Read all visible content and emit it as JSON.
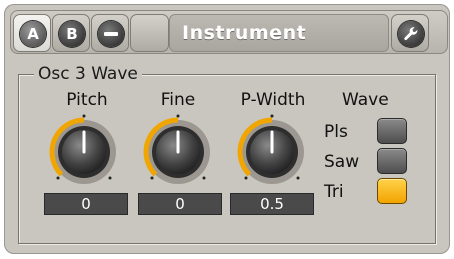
{
  "header": {
    "btn_a": "A",
    "btn_b": "B",
    "title": "Instrument",
    "icons": {
      "minus": "minus-icon",
      "wrench": "wrench-icon"
    }
  },
  "group": {
    "label": "Osc 3 Wave"
  },
  "knobs": [
    {
      "label": "Pitch",
      "value": "0"
    },
    {
      "label": "Fine",
      "value": "0"
    },
    {
      "label": "P-Width",
      "value": "0.5"
    }
  ],
  "wave": {
    "title": "Wave",
    "options": [
      {
        "label": "Pls",
        "selected": false
      },
      {
        "label": "Saw",
        "selected": false
      },
      {
        "label": "Tri",
        "selected": true
      }
    ]
  },
  "colors": {
    "accent": "#f5b000",
    "panel": "#c9c6bf",
    "value_box": "#4a4a4a"
  }
}
